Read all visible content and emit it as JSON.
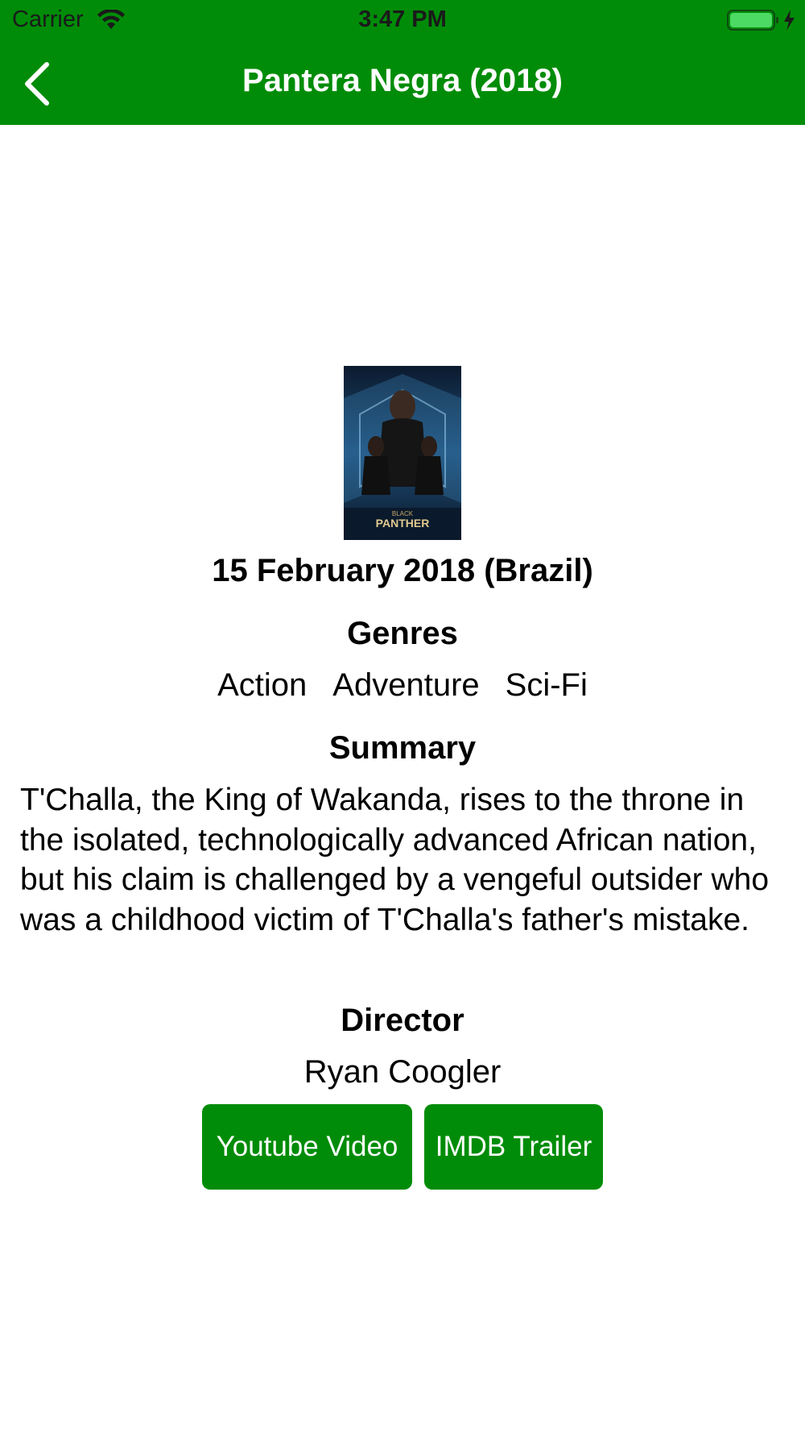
{
  "status_bar": {
    "carrier": "Carrier",
    "time": "3:47 PM",
    "wifi_icon": "wifi-icon",
    "battery_icon": "battery-charging-icon"
  },
  "nav": {
    "back_icon": "chevron-left-icon",
    "title": "Pantera Negra (2018)"
  },
  "movie": {
    "poster_title_line1": "BLACK",
    "poster_title_line2": "PANTHER",
    "release": "15 February 2018 (Brazil)",
    "genres_heading": "Genres",
    "genres": [
      "Action",
      "Adventure",
      "Sci-Fi"
    ],
    "summary_heading": "Summary",
    "summary": "T'Challa, the King of Wakanda, rises to the throne in the isolated, technologically advanced African nation, but his claim is challenged by a vengeful outsider who was a childhood victim of T'Challa's father's mistake.",
    "director_heading": "Director",
    "director": "Ryan Coogler"
  },
  "actions": {
    "youtube_label": "Youtube Video",
    "imdb_label": "IMDB Trailer"
  },
  "colors": {
    "accent": "#008c08",
    "text": "#000000",
    "background": "#ffffff"
  }
}
